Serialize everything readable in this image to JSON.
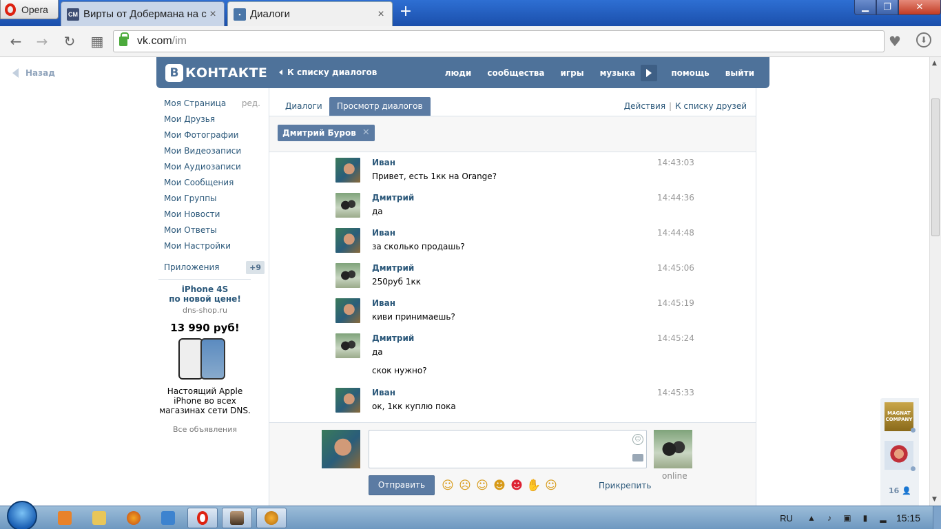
{
  "browser": {
    "menu_label": "Opera",
    "tabs": [
      {
        "favicon_text": "CM",
        "title": "Вирты от Добермана на с"
      },
      {
        "favicon_text": "",
        "title": "Диалоги"
      }
    ],
    "url_host": "vk.com",
    "url_path": "/im",
    "close_glyph": "×",
    "newtab_glyph": "+"
  },
  "page": {
    "back_label": "Назад",
    "logo_letter": "В",
    "logo_text": "КОНТАКТЕ",
    "back_to_list": "К списку диалогов",
    "top_menu": [
      "люди",
      "сообщества",
      "игры",
      "музыка",
      "помощь",
      "выйти"
    ],
    "left_menu": [
      {
        "label": "Моя Страница",
        "extra": "ред."
      },
      {
        "label": "Мои Друзья"
      },
      {
        "label": "Мои Фотографии"
      },
      {
        "label": "Мои Видеозаписи"
      },
      {
        "label": "Мои Аудиозаписи"
      },
      {
        "label": "Мои Сообщения"
      },
      {
        "label": "Мои Группы"
      },
      {
        "label": "Мои Новости"
      },
      {
        "label": "Мои Ответы"
      },
      {
        "label": "Мои Настройки"
      }
    ],
    "apps": {
      "label": "Приложения",
      "count": "+9"
    },
    "ad": {
      "headline_1": "iPhone 4S",
      "headline_2": "по новой цене!",
      "domain": "dns-shop.ru",
      "price": "13 990 руб!",
      "text_1": "Настоящий Apple",
      "text_2": "iPhone во всех",
      "text_3": "магазинах сети DNS.",
      "all_ads": "Все объявления"
    },
    "dialog_tabs": {
      "tab1": "Диалоги",
      "tab2": "Просмотр диалогов"
    },
    "actions": {
      "a1": "Действия",
      "sep": "|",
      "a2": "К списку друзей"
    },
    "peer_name": "Дмитрий Буров",
    "messages": [
      {
        "author": "Иван",
        "lines": [
          "Привет, есть 1кк на Orange?"
        ],
        "time": "14:43:03"
      },
      {
        "author": "Дмитрий",
        "lines": [
          "да"
        ],
        "time": "14:44:36"
      },
      {
        "author": "Иван",
        "lines": [
          "за сколько продашь?"
        ],
        "time": "14:44:48"
      },
      {
        "author": "Дмитрий",
        "lines": [
          "250руб 1кк"
        ],
        "time": "14:45:06"
      },
      {
        "author": "Иван",
        "lines": [
          "киви принимаешь?"
        ],
        "time": "14:45:19"
      },
      {
        "author": "Дмитрий",
        "lines": [
          "да",
          "скок нужно?"
        ],
        "time": "14:45:24"
      },
      {
        "author": "Иван",
        "lines": [
          "ок, 1кк куплю пока"
        ],
        "time": "14:45:33"
      }
    ],
    "compose": {
      "send": "Отправить",
      "attach": "Прикрепить",
      "peer_status": "online"
    },
    "right_widget": {
      "badge_text": "MAGNAT COMPANY",
      "friends_count": "16"
    }
  },
  "taskbar": {
    "lang": "RU",
    "clock": "15:15"
  }
}
